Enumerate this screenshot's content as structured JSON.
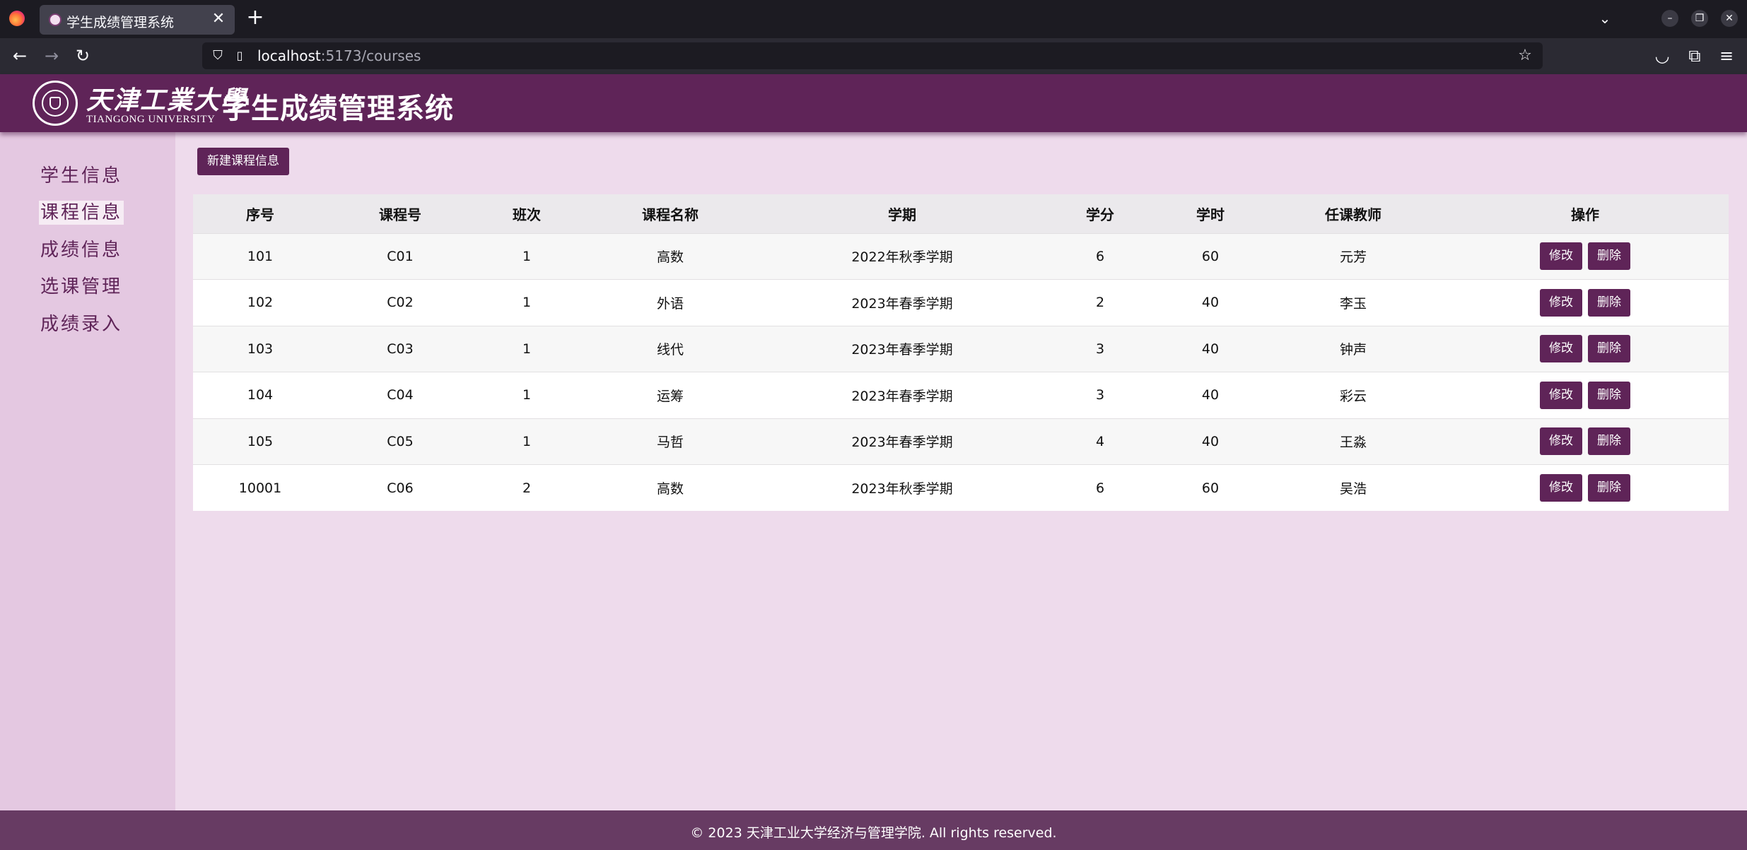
{
  "browser": {
    "tab_title": "学生成绩管理系统",
    "tab_close": "✕",
    "new_tab": "+",
    "list_tabs": "⌄",
    "url_host": "localhost",
    "url_path": ":5173/courses",
    "icons": {
      "back": "←",
      "forward": "→",
      "reload": "↻",
      "shield": "⛉",
      "page": "▯",
      "star": "☆",
      "pocket": "◡",
      "extensions": "⧉",
      "menu": "≡",
      "minimize": "–",
      "restore": "❐",
      "close": "✕"
    }
  },
  "header": {
    "logo_cn": "天津工業大學",
    "logo_en": "TIANGONG UNIVERSITY",
    "system_title": "学生成绩管理系统"
  },
  "sidebar": {
    "items": [
      {
        "label": "学生信息",
        "active": false
      },
      {
        "label": "课程信息",
        "active": true
      },
      {
        "label": "成绩信息",
        "active": false
      },
      {
        "label": "选课管理",
        "active": false
      },
      {
        "label": "成绩录入",
        "active": false
      }
    ]
  },
  "main": {
    "new_button": "新建课程信息",
    "table": {
      "headers": [
        "序号",
        "课程号",
        "班次",
        "课程名称",
        "学期",
        "学分",
        "学时",
        "任课教师",
        "操作"
      ],
      "rows": [
        [
          "101",
          "C01",
          "1",
          "高数",
          "2022年秋季学期",
          "6",
          "60",
          "元芳"
        ],
        [
          "102",
          "C02",
          "1",
          "外语",
          "2023年春季学期",
          "2",
          "40",
          "李玉"
        ],
        [
          "103",
          "C03",
          "1",
          "线代",
          "2023年春季学期",
          "3",
          "40",
          "钟声"
        ],
        [
          "104",
          "C04",
          "1",
          "运筹",
          "2023年春季学期",
          "3",
          "40",
          "彩云"
        ],
        [
          "105",
          "C05",
          "1",
          "马哲",
          "2023年春季学期",
          "4",
          "40",
          "王淼"
        ],
        [
          "10001",
          "C06",
          "2",
          "高数",
          "2023年秋季学期",
          "6",
          "60",
          "吴浩"
        ]
      ],
      "edit_label": "修改",
      "delete_label": "删除"
    }
  },
  "footer": {
    "text": "© 2023 天津工业大学经济与管理学院. All rights reserved."
  },
  "colors": {
    "brand": "#5f2458",
    "page_bg": "#eedbec",
    "sidebar_bg": "#e4c8e1",
    "footer_bg": "#673b63"
  }
}
